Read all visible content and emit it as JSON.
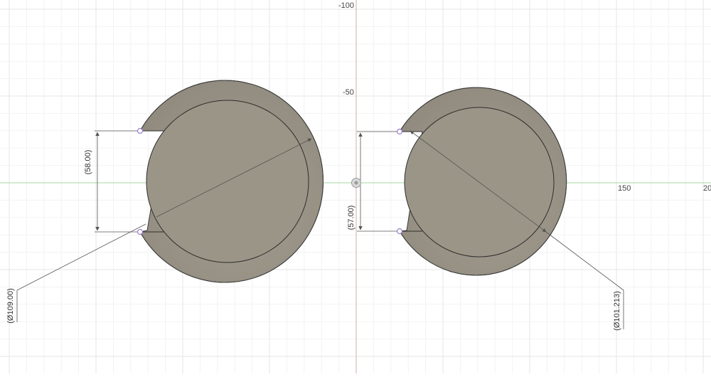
{
  "viewport": {
    "axis_labels": {
      "y_minus_100": "-100",
      "y_minus_50": "-50",
      "x_150": "150",
      "x_200_partial": "20"
    },
    "colors": {
      "background": "#ffffff",
      "grid_minor": "#f3f3f3",
      "grid_major": "#e4e4e4",
      "x_axis": "#a6d8a6",
      "y_axis": "#d9a9a9",
      "body_fill": "#8a8578",
      "body_stroke": "#3a3a3a",
      "dimension_line": "#555555",
      "constraint_point": "#9a7fd0",
      "dimension_text": "#333333"
    }
  },
  "sketch": {
    "left_profile": {
      "vertical_dimension": "(58.00)",
      "diameter_dimension": "(Ø109.00)"
    },
    "right_profile": {
      "vertical_dimension": "(57.00)",
      "diameter_dimension": "(Ø101.213)"
    }
  }
}
